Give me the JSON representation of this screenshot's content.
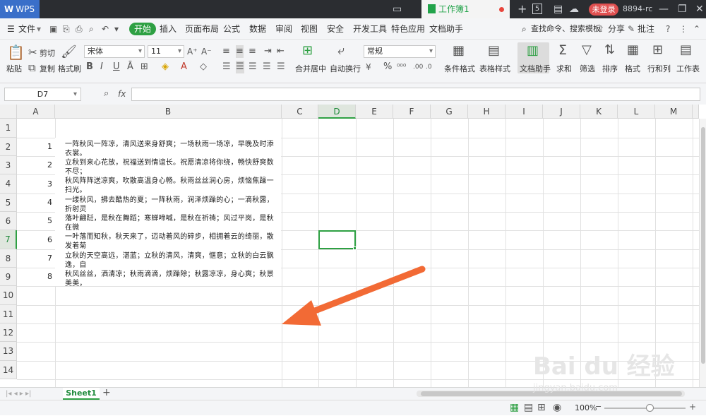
{
  "titlebar": {
    "app": "WPS",
    "doc_tab": "工作簿1",
    "login": "未登录",
    "user": "8894-rc",
    "tab_count": "5"
  },
  "menubar": {
    "file": "文件",
    "items": [
      "开始",
      "插入",
      "页面布局",
      "公式",
      "数据",
      "审阅",
      "视图",
      "安全",
      "开发工具",
      "特色应用",
      "文档助手"
    ],
    "search": "查找命令、搜索模板",
    "share": "分享",
    "comment": "批注"
  },
  "ribbon": {
    "paste": "粘贴",
    "cut": "剪切",
    "copy": "复制",
    "format_painter": "格式刷",
    "font": "宋体",
    "font_size": "11",
    "merge": "合并居中",
    "wrap": "自动换行",
    "number_format": "常规",
    "cond_format": "条件格式",
    "table_style": "表格样式",
    "doc_helper": "文档助手",
    "sum": "求和",
    "filter": "筛选",
    "sort": "排序",
    "format": "格式",
    "rowcol": "行和列",
    "worksheet": "工作表"
  },
  "formula": {
    "cell_ref": "D7",
    "fx": "fx",
    "value": ""
  },
  "columns": [
    "A",
    "B",
    "C",
    "D",
    "E",
    "F",
    "G",
    "H",
    "I",
    "J",
    "K",
    "L",
    "M"
  ],
  "rows": [
    "1",
    "2",
    "3",
    "4",
    "5",
    "6",
    "7",
    "8",
    "9",
    "10",
    "11",
    "12",
    "13",
    "14"
  ],
  "cells": [
    {
      "a": "1",
      "b": "一阵秋风一阵凉，清风送来身舒爽；一场秋雨一场凉，早晚及时添衣裳。\n秋霞莹莹耀眼亮，秋实累累心欢畅。美景在眼看不尽，祝福声声情绵长。"
    },
    {
      "a": "2",
      "b": "立秋到来心花放，祝福送到情谊长。祝愿清凉将你绕，畅快舒爽数不尽；\n祝愿美景身边傍，悠闲惬意数不尽；愿你收获满箩筐，快乐幸福数不尽；"
    },
    {
      "a": "3",
      "b": "秋风阵阵送凉爽，吹散高温身心畅。秋雨丝丝润心房，烦恼焦躁一扫光。\n好运高照万事顺，生活美满笑脸扬。立秋到，愿你心情舒畅，快乐徜徉。"
    },
    {
      "a": "4",
      "b": "一缕秋风，拂去酷热的夏；一阵秋雨，润泽烦躁的心；一滴秋露，折射灵\n魄的秋；一丝秋意，渲染美丽的景。立秋到了，愿你时刻开怀，惬意逍"
    },
    {
      "a": "5",
      "b": "落叶翩跹，是秋在舞蹈；寒蝉啼喊，是秋在祈祷；风过平岗，是秋在微\n笑；雁飞南方，是秋在奔跑。秋意中，思念翻转，五彩斑斓，有记忆的灿"
    },
    {
      "a": "6",
      "b": "一叶落而知秋，秋天来了，迈动着风的碎步，相拥着云的绮丽，散发着菊\n的芬芳，沐浴着甘霖雨露，摇曳着果的份量，游走着五彩的梦。于是，炎"
    },
    {
      "a": "7",
      "b": "立秋的天空高远，湛蓝；立秋的清风，清爽，惬意；立秋的白云飘逸，自\n在。立秋的溪流欢畅，清澈；立秋的祝福美好，真纯。愿你立秋快乐。"
    },
    {
      "a": "8",
      "b": "秋风丝丝，洒清凉；秋雨滴滴，烦躁除；秋露凉凉，身心爽；秋景美美，\n饱眼福；秋意蒙蒙，心陶醉；立秋来到，乐开怀。愿你立秋惬意，舒爽无"
    }
  ],
  "sheet_tab": "Sheet1",
  "status": {
    "zoom": "100%"
  },
  "watermark": {
    "brand": "Bai du 经验",
    "url": "jingyan.baidu.com"
  },
  "colors": {
    "accent": "#2ea043",
    "arrow": "#f26a35",
    "titlebar": "#2b2d31"
  }
}
